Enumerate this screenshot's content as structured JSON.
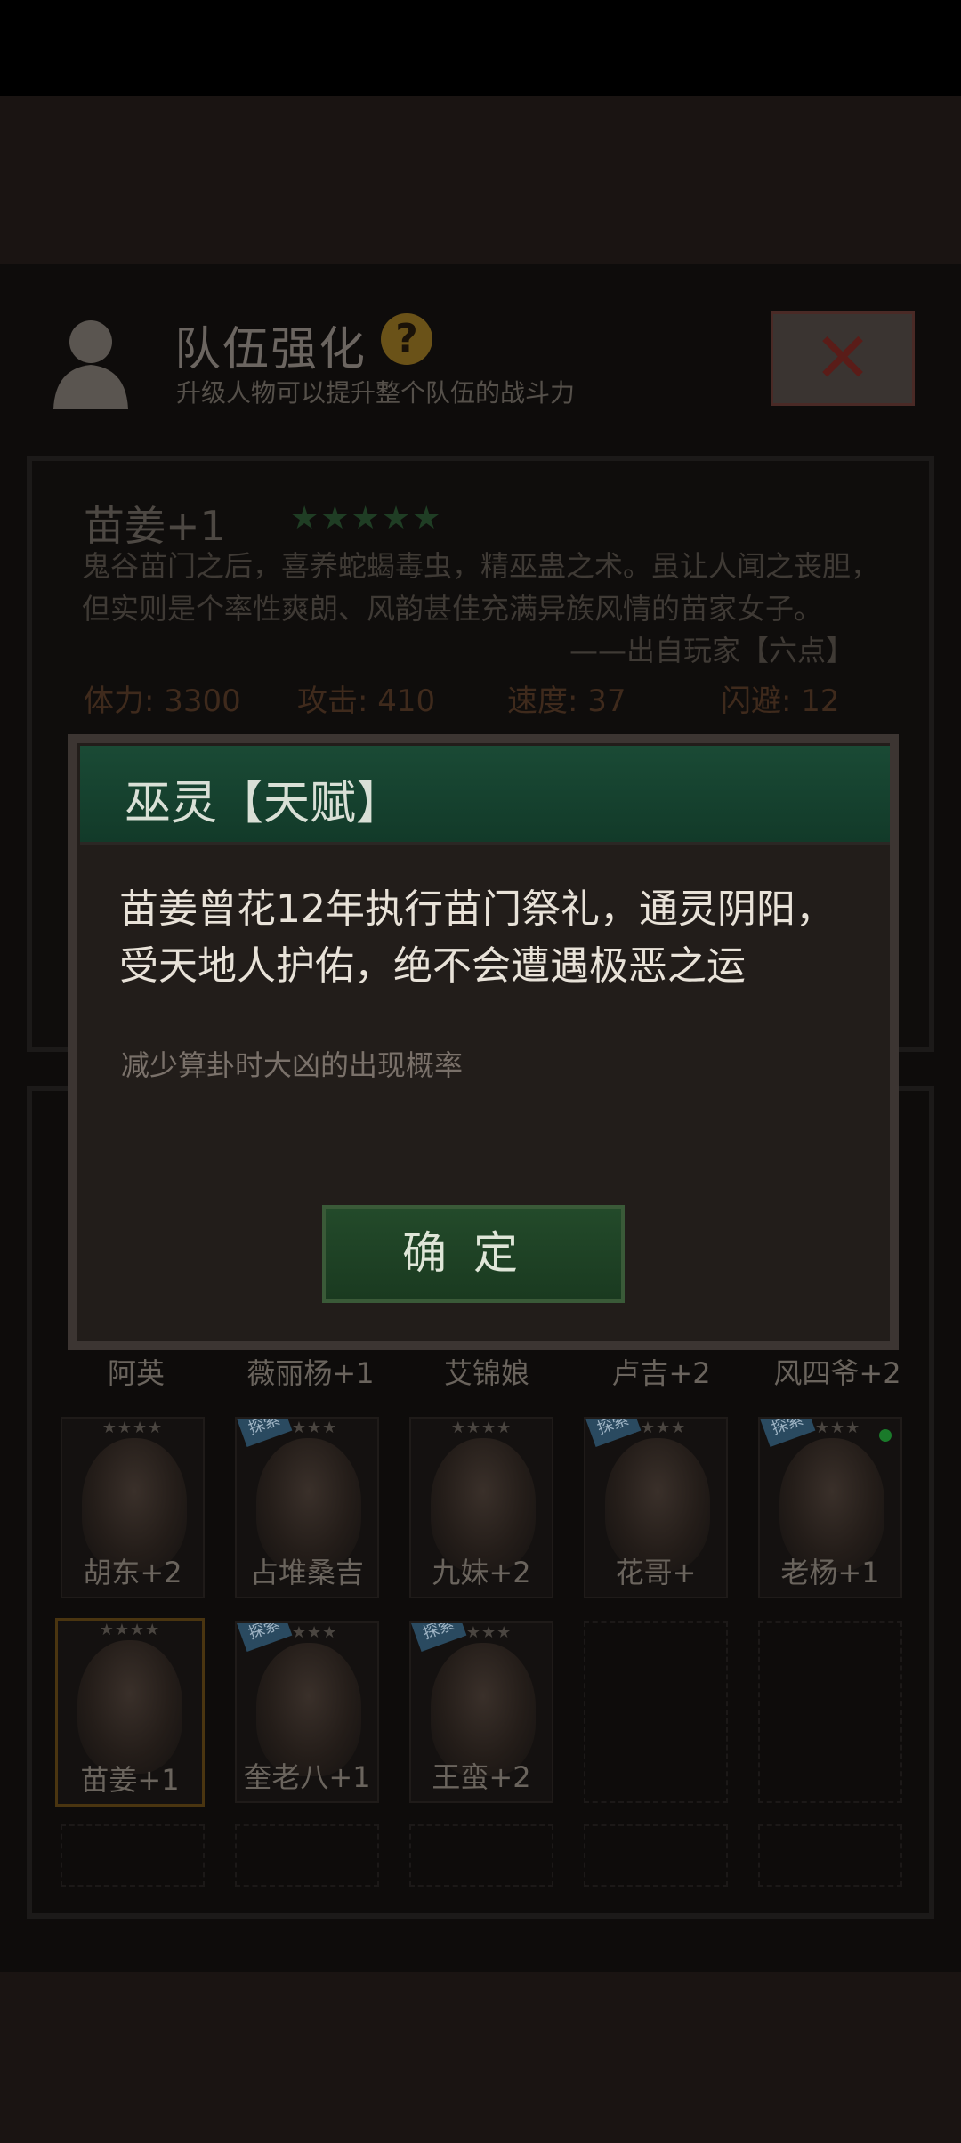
{
  "header": {
    "title": "队伍强化",
    "help_icon": "?",
    "subtitle": "升级人物可以提升整个队伍的战斗力",
    "close_icon": "✕"
  },
  "character": {
    "name": "苗姜+1",
    "stars": "★★★★★",
    "description": "鬼谷苗门之后，喜养蛇蝎毒虫，精巫蛊之术。虽让人闻之丧胆，但实则是个率性爽朗、风韵甚佳充满异族风情的苗家女子。",
    "source": "——出自玩家【六点】",
    "stats": {
      "hp": "体力: 3300",
      "attack": "攻击: 410",
      "speed": "速度: 37",
      "dodge": "闪避: 12"
    }
  },
  "roster": {
    "row1": [
      "阿英",
      "薇丽杨+1",
      "艾锦娘",
      "卢吉+2",
      "风四爷+2"
    ],
    "row2": [
      {
        "label": "胡东+2",
        "stars": "★★★★",
        "tag": ""
      },
      {
        "label": "占堆桑吉",
        "stars": "★★★★",
        "tag": "探索"
      },
      {
        "label": "九妹+2",
        "stars": "★★★★",
        "tag": ""
      },
      {
        "label": "花哥+",
        "stars": "★★★★",
        "tag": "探索"
      },
      {
        "label": "老杨+1",
        "stars": "★★★★",
        "tag": "探索"
      }
    ],
    "row3": [
      {
        "label": "苗姜+1",
        "stars": "★★★★",
        "tag": ""
      },
      {
        "label": "奎老八+1",
        "stars": "★★★★",
        "tag": "探索"
      },
      {
        "label": "王蛮+2",
        "stars": "★★★★",
        "tag": "探索"
      }
    ]
  },
  "dialog": {
    "title": "巫灵【天赋】",
    "body": "苗姜曾花12年执行苗门祭礼，通灵阴阳，受天地人护佑，绝不会遭遇极恶之运",
    "note": "减少算卦时大凶的出现概率",
    "confirm": "确定"
  }
}
